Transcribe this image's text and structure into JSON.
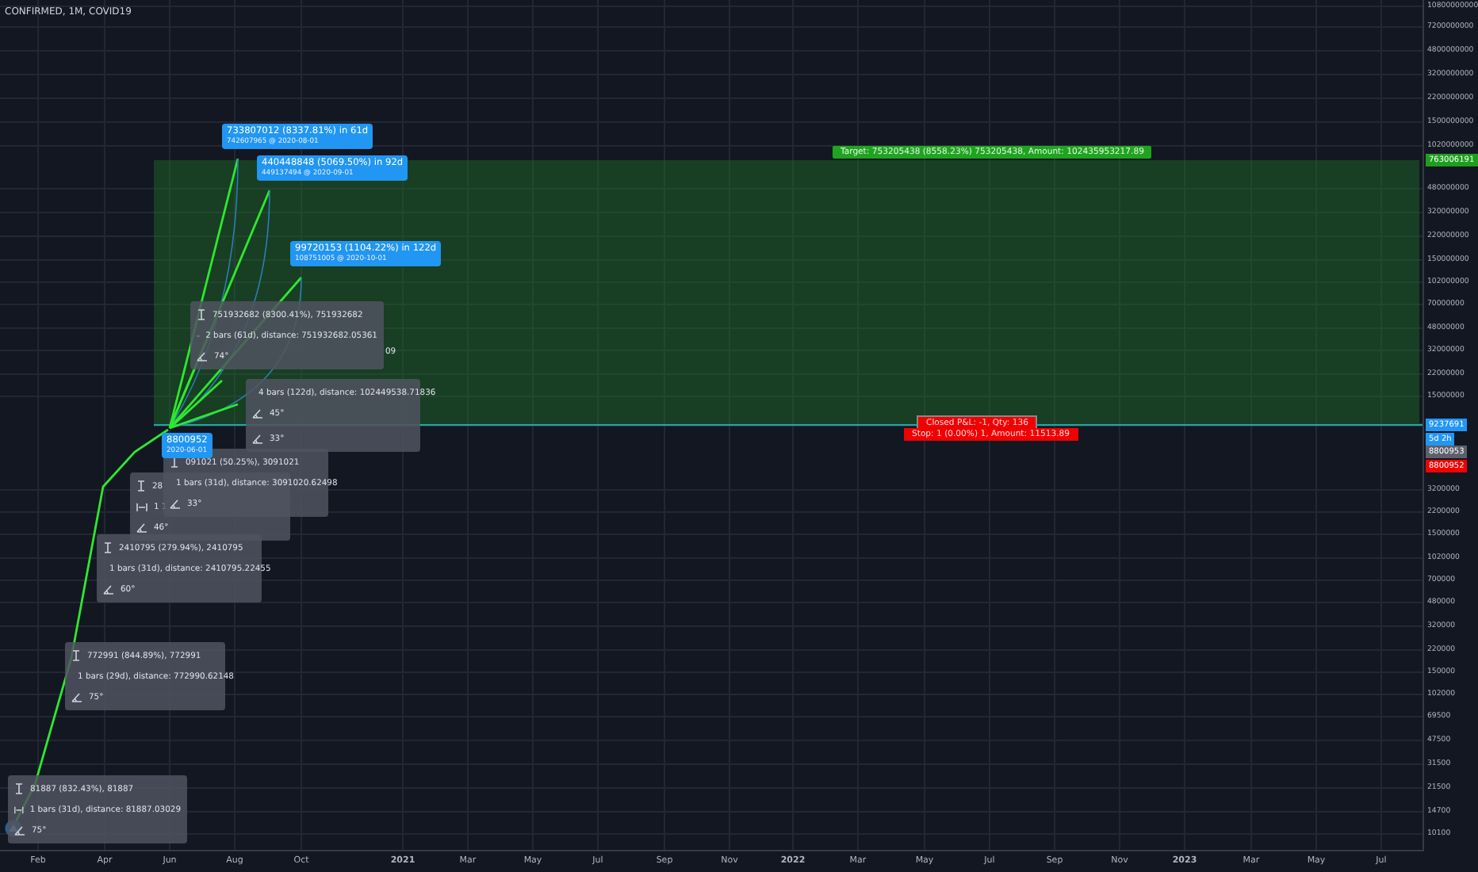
{
  "chart": {
    "title": "CONFIRMED, 1M, COVID19"
  },
  "measure_boxes": [
    {
      "rows": [
        {
          "kind": "price",
          "text": "81887 (832.43%), 81887"
        },
        {
          "kind": "range",
          "text": "1 bars (31d), distance: 81887.03029"
        },
        {
          "kind": "angle",
          "text": "75°"
        }
      ]
    },
    {
      "rows": [
        {
          "kind": "price",
          "text": "772991 (844.89%), 772991"
        },
        {
          "kind": "range",
          "text": "1 bars (29d), distance: 772990.62148"
        },
        {
          "kind": "angle",
          "text": "75°"
        }
      ]
    },
    {
      "rows": [
        {
          "kind": "price",
          "text": "2410795 (279.94%), 2410795"
        },
        {
          "kind": "range",
          "text": "1 bars (31d), distance: 2410795.22455"
        },
        {
          "kind": "angle",
          "text": "60°"
        }
      ]
    },
    {
      "rows": [
        {
          "kind": "price",
          "text": "28"
        },
        {
          "kind": "range",
          "text": "1 1"
        },
        {
          "kind": "angle",
          "text": "46°"
        }
      ]
    },
    {
      "rows": [
        {
          "kind": "price",
          "text": "091021 (50.25%), 3091021"
        },
        {
          "kind": "range",
          "text": "1 bars (31d), distance: 3091020.62498"
        },
        {
          "kind": "angle",
          "text": "33°"
        }
      ]
    },
    {
      "rows": [
        {
          "kind": "price",
          "text": "751932682 (8300.41%), 751932682"
        },
        {
          "kind": "range",
          "text": "2 bars (61d), distance: 751932682.05361"
        },
        {
          "kind": "angle",
          "text": "74°"
        }
      ]
    },
    {
      "rows": [
        {
          "kind": "range",
          "text": "4 bars (122d), distance: 102449538.71836"
        },
        {
          "kind": "angle",
          "text": "45°"
        }
      ]
    },
    {
      "rows": [
        {
          "kind": "angle",
          "text": "33°"
        }
      ]
    }
  ],
  "fragments": [
    "09"
  ],
  "projection_labels": [
    {
      "title": "733807012 (8337.81%) in 61d",
      "subtitle": "742607965 @ 2020-08-01"
    },
    {
      "title": "440448848 (5069.50%) in 92d",
      "subtitle": "449137494 @ 2020-09-01"
    },
    {
      "title": "99720153 (1104.22%) in 122d",
      "subtitle": "108751005 @ 2020-10-01"
    }
  ],
  "point_label": {
    "value": "8800952",
    "date": "2020-06-01"
  },
  "position_tool": {
    "target": "Target: 753205438 (8558.23%) 753205438, Amount: 102435953217.89",
    "closed_pnl": "Closed P&L: -1, Qty: 136",
    "stop": "Stop: 1 (0.00%) 1, Amount: 11513.89"
  },
  "price_axis": {
    "ticks": [
      "10800000000",
      "7200000000",
      "4800000000",
      "3200000000",
      "2200000000",
      "1500000000",
      "1020000000",
      "480000000",
      "320000000",
      "220000000",
      "150000000",
      "102000000",
      "70000000",
      "48000000",
      "32000000",
      "22000000",
      "15000000",
      "3200000",
      "2200000",
      "1500000",
      "1020000",
      "700000",
      "480000",
      "320000",
      "220000",
      "150000",
      "102000",
      "69500",
      "47500",
      "31500",
      "21500",
      "14700",
      "10100"
    ],
    "badges": [
      {
        "text": "763006191",
        "color": "#1e9e1e"
      },
      {
        "text": "9237691",
        "color": "#2196f3"
      },
      {
        "text": "5d 2h",
        "color": "#2196f3"
      },
      {
        "text": "8800953",
        "color": "#5d606b"
      },
      {
        "text": "8800952",
        "color": "#f00000"
      }
    ]
  },
  "time_axis": {
    "labels": [
      {
        "text": "Feb",
        "major": false
      },
      {
        "text": "Apr",
        "major": false
      },
      {
        "text": "Jun",
        "major": false
      },
      {
        "text": "Aug",
        "major": false
      },
      {
        "text": "Oct",
        "major": false
      },
      {
        "text": "2021",
        "major": true
      },
      {
        "text": "Mar",
        "major": false
      },
      {
        "text": "May",
        "major": false
      },
      {
        "text": "Jul",
        "major": false
      },
      {
        "text": "Sep",
        "major": false
      },
      {
        "text": "Nov",
        "major": false
      },
      {
        "text": "2022",
        "major": true
      },
      {
        "text": "Mar",
        "major": false
      },
      {
        "text": "May",
        "major": false
      },
      {
        "text": "Jul",
        "major": false
      },
      {
        "text": "Sep",
        "major": false
      },
      {
        "text": "Nov",
        "major": false
      },
      {
        "text": "2023",
        "major": true
      },
      {
        "text": "Mar",
        "major": false
      },
      {
        "text": "May",
        "major": false
      },
      {
        "text": "Jul",
        "major": false
      }
    ]
  }
}
